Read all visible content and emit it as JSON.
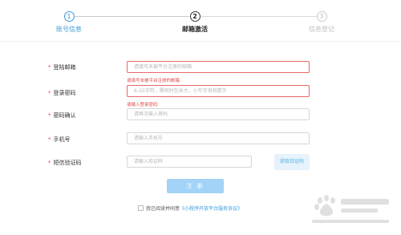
{
  "steps": [
    {
      "num": "1",
      "label": "账号信息"
    },
    {
      "num": "2",
      "label": "邮箱激活"
    },
    {
      "num": "3",
      "label": "信息登记"
    }
  ],
  "form": {
    "email": {
      "required": "*",
      "label": "登陆邮箱",
      "placeholder": "请填写未被平台注册的邮箱",
      "error": "请填写未被平台注册的邮箱"
    },
    "password": {
      "required": "*",
      "label": "登录密码",
      "placeholder": "6-20字符，需同时包含大、小写字母和数字",
      "error": "请输入登录密码"
    },
    "confirm": {
      "required": "*",
      "label": "密码确认",
      "placeholder": "请再次输入密码"
    },
    "phone": {
      "required": "*",
      "label": "手机号",
      "placeholder": "请输入手机号"
    },
    "sms": {
      "required": "*",
      "label": "短信验证码",
      "placeholder": "请输入验证码",
      "button": "获取验证码"
    }
  },
  "submit_label": "注 册",
  "agreement": {
    "prefix": "我已阅读并同意",
    "link": "《小程序开放平台服务协议》"
  },
  "colors": {
    "accent": "#3d9bd9",
    "error": "#e24a4a",
    "button": "#a3d3f6"
  },
  "icons": {
    "checkbox": "checkbox-icon",
    "watermark": "baidu-jingyan-watermark"
  }
}
